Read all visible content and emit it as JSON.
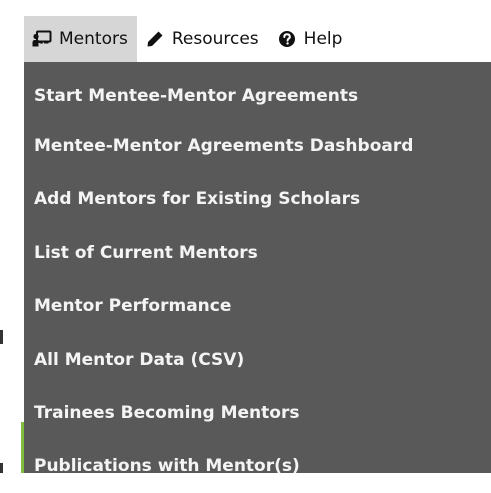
{
  "nav": {
    "items": [
      {
        "label": "Mentors",
        "icon": "chalkboard-teacher-icon",
        "active": true
      },
      {
        "label": "Resources",
        "icon": "pencil-icon",
        "active": false
      },
      {
        "label": "Help",
        "icon": "question-circle-icon",
        "active": false
      }
    ]
  },
  "dropdown": {
    "items": [
      {
        "label": "Start Mentee-Mentor Agreements"
      },
      {
        "label": "Mentee-Mentor Agreements Dashboard"
      },
      {
        "label": "Add Mentors for Existing Scholars"
      },
      {
        "label": "List of Current Mentors"
      },
      {
        "label": "Mentor Performance"
      },
      {
        "label": "All Mentor Data (CSV)"
      },
      {
        "label": "Trainees Becoming Mentors"
      },
      {
        "label": "Publications with Mentor(s)"
      }
    ]
  },
  "colors": {
    "menu_background": "#595959",
    "menu_text": "#f4f4f4",
    "active_tab": "#d6d6d6"
  }
}
